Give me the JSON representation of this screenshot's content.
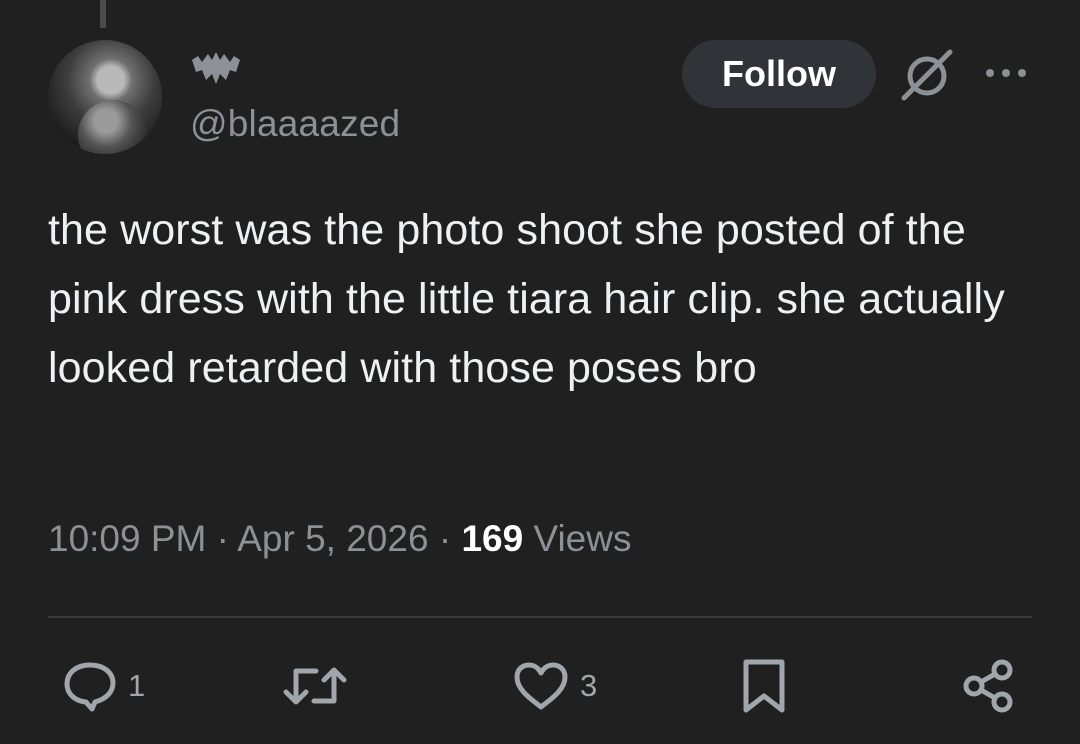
{
  "tweet": {
    "handle": "@blaaaazed",
    "text": "the worst was the photo shoot she posted of the pink dress with the little tiara hair clip. she actually looked retarded with those poses bro",
    "time": "10:09 PM",
    "separator": "·",
    "date": "Apr 5, 2026",
    "views_count": "169",
    "views_label": "Views"
  },
  "header": {
    "follow_label": "Follow",
    "badge_icon": "bat-icon",
    "grok_icon": "grok-icon",
    "more_icon": "more-icon"
  },
  "actions": {
    "reply_count": "1",
    "like_count": "3",
    "icons": [
      "reply-icon",
      "retweet-icon",
      "like-icon",
      "bookmark-icon",
      "share-icon"
    ]
  },
  "colors": {
    "background": "#202020",
    "text": "#e7e9ea",
    "muted": "#8b9197",
    "follow_bg": "#303438"
  }
}
